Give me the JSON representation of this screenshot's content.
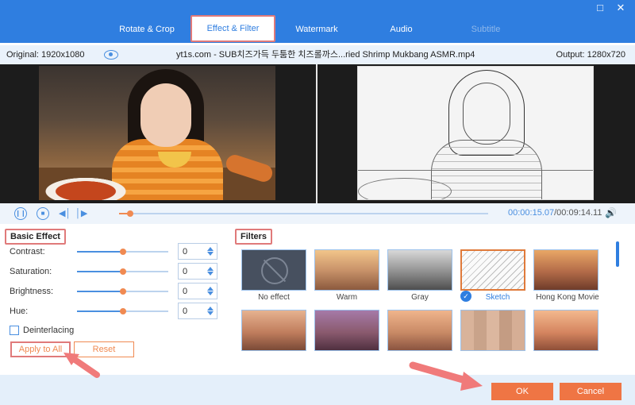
{
  "tabs": [
    {
      "label": "Rotate & Crop"
    },
    {
      "label": "Effect & Filter"
    },
    {
      "label": "Watermark"
    },
    {
      "label": "Audio"
    },
    {
      "label": "Subtitle"
    }
  ],
  "window": {
    "restore_icon": "restore-icon",
    "close_icon": "close-icon"
  },
  "info": {
    "original": "Original: 1920x1080",
    "filename": "yt1s.com - SUB치즈가득 두툼한 치즈롤까스...ried Shrimp Mukbang ASMR.mp4",
    "output": "Output: 1280x720"
  },
  "player": {
    "current_time": "00:00:15.07",
    "total_time": "/00:09:14.11",
    "progress": 0.03
  },
  "basic_effect": {
    "title": "Basic Effect",
    "rows": [
      {
        "label": "Contrast:",
        "value": "0",
        "level": 0.5
      },
      {
        "label": "Saturation:",
        "value": "0",
        "level": 0.5
      },
      {
        "label": "Brightness:",
        "value": "0",
        "level": 0.5
      },
      {
        "label": "Hue:",
        "value": "0",
        "level": 0.5
      }
    ],
    "deinterlacing": "Deinterlacing",
    "apply_all": "Apply to All",
    "reset": "Reset"
  },
  "filters": {
    "title": "Filters",
    "items": [
      {
        "label": "No effect"
      },
      {
        "label": "Warm"
      },
      {
        "label": "Gray"
      },
      {
        "label": "Sketch"
      },
      {
        "label": "Hong Kong Movie"
      }
    ],
    "selected": "Sketch"
  },
  "footer": {
    "ok": "OK",
    "cancel": "Cancel"
  },
  "colors": {
    "accent": "#2f7ee0",
    "primary": "#ef7544",
    "highlight": "#e07a7a"
  }
}
